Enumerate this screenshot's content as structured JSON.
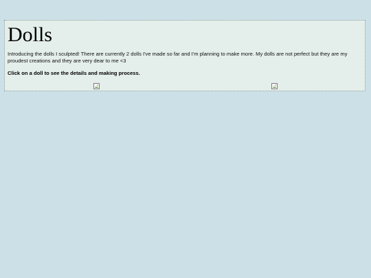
{
  "page": {
    "title": "Dolls",
    "intro": "Introducing the dolls I sculpted! There are currently 2 dolls I've made so far and I'm planning to make more. My dolls are not perfect but they are my proudest creations and they are very dear to me <3",
    "instruction": "Click on a doll to see the details and making process."
  },
  "dolls": [
    {
      "icon": "broken-image-icon"
    },
    {
      "icon": "broken-image-icon"
    }
  ],
  "colors": {
    "background": "#cce1e7",
    "panel": "#e4eeea",
    "panel_border": "#8a9a98"
  }
}
